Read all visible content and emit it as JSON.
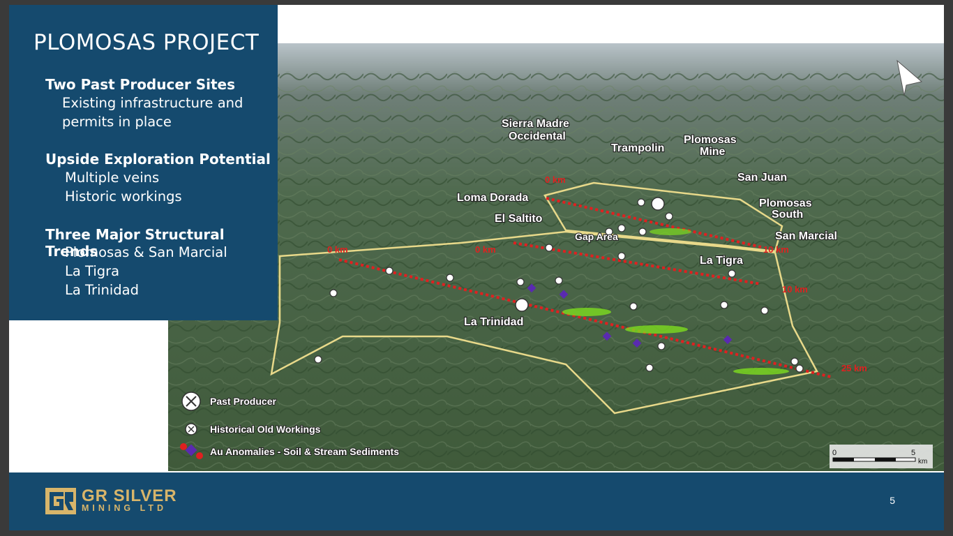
{
  "panel": {
    "title": "PLOMOSAS PROJECT",
    "sections": [
      {
        "heading": "Two Past Producer Sites",
        "items": [
          "Existing infrastructure and",
          "permits in place"
        ]
      },
      {
        "heading": "Upside Exploration Potential",
        "items": [
          "Multiple veins",
          "Historic workings"
        ]
      },
      {
        "heading": "Three Major Structural Trends",
        "items": [
          "Plomosas & San Marcial",
          "La Tigra",
          "La Trinidad"
        ]
      }
    ]
  },
  "map": {
    "labels": {
      "sierra_madre_1": "Sierra Madre",
      "sierra_madre_2": "Occidental",
      "trampolin": "Trampolin",
      "plomosas_mine_1": "Plomosas",
      "plomosas_mine_2": "Mine",
      "san_juan": "San Juan",
      "loma_dorada": "Loma Dorada",
      "plomosas_south_1": "Plomosas",
      "plomosas_south_2": "South",
      "el_saltito": "El Saltito",
      "gap_area": "Gap Area",
      "san_marcial": "San Marcial",
      "la_tigra": "La Tigra",
      "la_trinidad": "La Trinidad"
    },
    "km_markers": [
      "0 km",
      "10 km",
      "0 km",
      "0 km",
      "10 km",
      "25 km"
    ],
    "legend": {
      "past_producer": "Past Producer",
      "historical": "Historical Old Workings",
      "au_anomalies": "Au Anomalies - Soil & Stream Sediments"
    },
    "scale": {
      "left": "0",
      "right": "5",
      "unit": "km"
    },
    "colors": {
      "trend": "#e02020",
      "boundary": "#e8d98a",
      "anomaly_purple": "#5a2ab0",
      "anomaly_green": "#7ddc1f"
    }
  },
  "footer": {
    "logo_line1": "GR SILVER",
    "logo_line2": "MINING LTD",
    "page_number": "5"
  }
}
